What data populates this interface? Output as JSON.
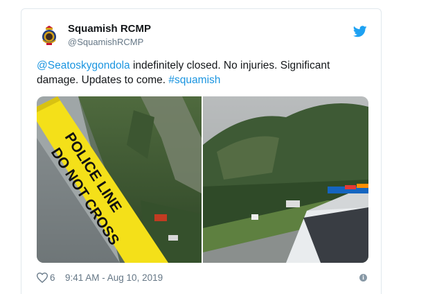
{
  "account": {
    "display_name": "Squamish RCMP",
    "handle": "@SquamishRCMP",
    "avatar_icon": "rcmp-crest-icon"
  },
  "tweet": {
    "mention": "@Seatoskygondola",
    "text_after_mention": " indefinitely closed. No injuries. Significant damage. Updates to come. ",
    "hashtag": "#squamish"
  },
  "media": {
    "left_photo": {
      "tape_line_1": "POLICE LINE",
      "tape_line_2": "DO NOT CROSS"
    }
  },
  "footer": {
    "like_count": "6",
    "timestamp": "9:41 AM - Aug 10, 2019",
    "info_icon_label": "i"
  },
  "colors": {
    "link": "#1b95e0",
    "text": "#14171a",
    "muted": "#657786",
    "twitter_bird": "#1da1f2"
  }
}
